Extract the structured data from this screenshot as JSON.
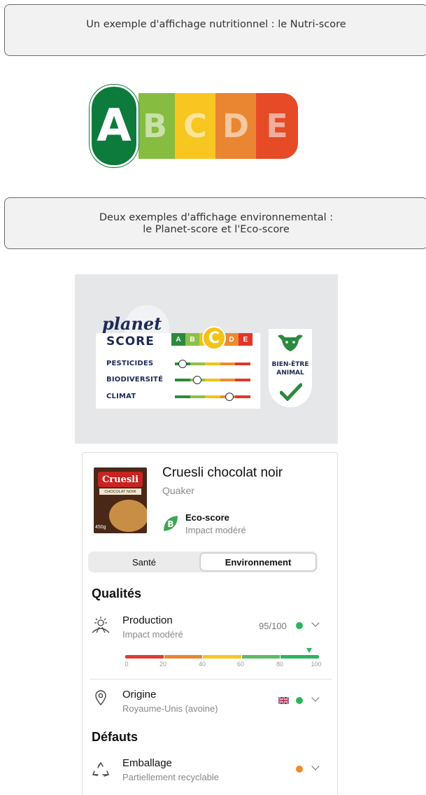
{
  "captions": {
    "nutri": "Un exemple d'affichage nutritionnel : le Nutri-score",
    "env_line1": "Deux exemples d'affichage environnemental :",
    "env_line2": "le Planet-score et l'Eco-score"
  },
  "nutriscore": {
    "grades": [
      "A",
      "B",
      "C",
      "D",
      "E"
    ],
    "selected": "A",
    "colors": [
      "#0c7b3b",
      "#86bc40",
      "#f8c620",
      "#ea8631",
      "#e54b26"
    ]
  },
  "planet_score": {
    "logo_top": "planet",
    "logo_bottom": "SCORE",
    "grades": [
      "A",
      "B",
      "C",
      "D",
      "E"
    ],
    "selected": "C",
    "rows": [
      {
        "label": "PESTICIDES",
        "level": 0.1
      },
      {
        "label": "BIODIVERSITÉ",
        "level": 0.3
      },
      {
        "label": "CLIMAT",
        "level": 0.72
      }
    ],
    "badge_line1": "BIEN-ÊTRE",
    "badge_line2": "ANIMAL"
  },
  "product": {
    "name": "Cruesli chocolat noir",
    "brand": "Quaker",
    "package_brand": "Cruesli",
    "package_variant": "CHOCOLAT NOIR",
    "package_weight": "450g",
    "eco_grade": "B",
    "eco_title": "Eco-score",
    "eco_impact": "Impact modéré"
  },
  "tabs": [
    {
      "label": "Santé",
      "active": false
    },
    {
      "label": "Environnement",
      "active": true
    }
  ],
  "sections": {
    "qualites": "Qualités",
    "defauts": "Défauts"
  },
  "production": {
    "label": "Production",
    "sub": "Impact modéré",
    "score": "95/100",
    "dot_color": "#2bb55e",
    "score_value": 95,
    "scale_ticks": [
      "0",
      "20",
      "40",
      "60",
      "80",
      "100"
    ]
  },
  "origine": {
    "label": "Origine",
    "sub": "Royaume-Unis (avoine)",
    "dot_color": "#2bb55e"
  },
  "emballage": {
    "label": "Emballage",
    "sub": "Partiellement recyclable",
    "dot_color": "#ef8c2b"
  }
}
